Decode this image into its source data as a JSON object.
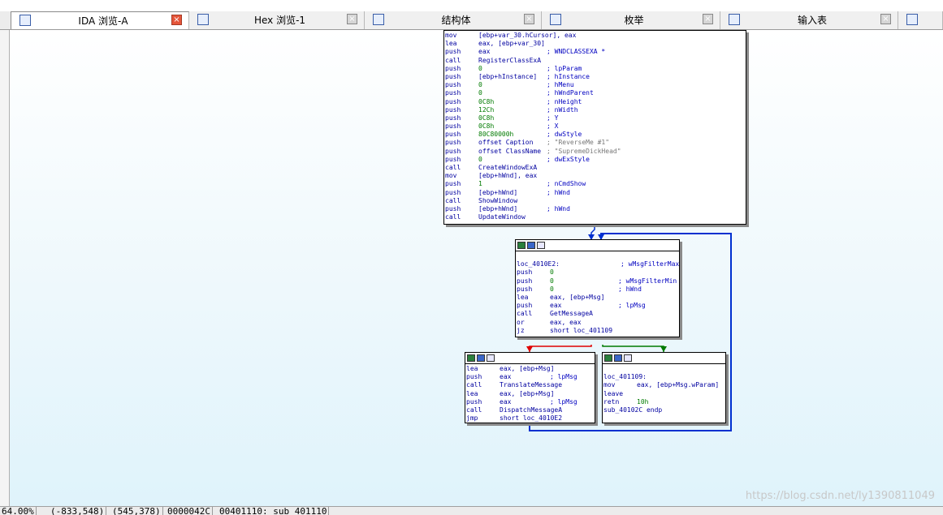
{
  "tabs": [
    {
      "label": "IDA 浏览-A",
      "icon": "ida-view-icon",
      "active": true
    },
    {
      "label": "Hex 浏览-1",
      "icon": "hex-view-icon",
      "active": false
    },
    {
      "label": "结构体",
      "icon": "structures-icon",
      "active": false
    },
    {
      "label": "枚举",
      "icon": "enums-icon",
      "active": false
    },
    {
      "label": "输入表",
      "icon": "imports-icon",
      "active": false
    }
  ],
  "nodes": {
    "main": [
      [
        "mov",
        "[ebp+var_30.hCursor], eax",
        ""
      ],
      [
        "lea",
        "eax, [ebp+var_30]",
        ""
      ],
      [
        "push",
        "eax",
        "; WNDCLASSEXA *"
      ],
      [
        "call",
        "RegisterClassExA",
        ""
      ],
      [
        "push",
        "0",
        "; lpParam"
      ],
      [
        "push",
        "[ebp+hInstance]",
        "; hInstance"
      ],
      [
        "push",
        "0",
        "; hMenu"
      ],
      [
        "push",
        "0",
        "; hWndParent"
      ],
      [
        "push",
        "0C8h",
        "; nHeight"
      ],
      [
        "push",
        "12Ch",
        "; nWidth"
      ],
      [
        "push",
        "0C8h",
        "; Y"
      ],
      [
        "push",
        "0C8h",
        "; X"
      ],
      [
        "push",
        "80C80000h",
        "; dwStyle"
      ],
      [
        "push",
        "offset Caption",
        "; \"ReverseMe #1\""
      ],
      [
        "push",
        "offset ClassName",
        "; \"SupremeDickHead\""
      ],
      [
        "push",
        "0",
        "; dwExStyle"
      ],
      [
        "call",
        "CreateWindowExA",
        ""
      ],
      [
        "mov",
        "[ebp+hWnd], eax",
        ""
      ],
      [
        "push",
        "1",
        "; nCmdShow"
      ],
      [
        "push",
        "[ebp+hWnd]",
        "; hWnd"
      ],
      [
        "call",
        "ShowWindow",
        ""
      ],
      [
        "push",
        "[ebp+hWnd]",
        "; hWnd"
      ],
      [
        "call",
        "UpdateWindow",
        ""
      ]
    ],
    "loop": [
      [
        "",
        "",
        ""
      ],
      [
        "loc_4010E2:",
        "",
        "; wMsgFilterMax"
      ],
      [
        "push",
        "0",
        ""
      ],
      [
        "push",
        "0",
        "; wMsgFilterMin"
      ],
      [
        "push",
        "0",
        "; hWnd"
      ],
      [
        "lea",
        "eax, [ebp+Msg]",
        ""
      ],
      [
        "push",
        "eax",
        "; lpMsg"
      ],
      [
        "call",
        "GetMessageA",
        ""
      ],
      [
        "or",
        "eax, eax",
        ""
      ],
      [
        "jz",
        "short loc_401109",
        ""
      ]
    ],
    "dispatch": [
      [
        "lea",
        "eax, [ebp+Msg]",
        ""
      ],
      [
        "push",
        "eax",
        "; lpMsg"
      ],
      [
        "call",
        "TranslateMessage",
        ""
      ],
      [
        "lea",
        "eax, [ebp+Msg]",
        ""
      ],
      [
        "push",
        "eax",
        "; lpMsg"
      ],
      [
        "call",
        "DispatchMessageA",
        ""
      ],
      [
        "jmp",
        "short loc_4010E2",
        ""
      ]
    ],
    "exit": [
      [
        "",
        "",
        ""
      ],
      [
        "loc_401109:",
        "",
        ""
      ],
      [
        "mov",
        "eax, [ebp+Msg.wParam]",
        ""
      ],
      [
        "leave",
        "",
        ""
      ],
      [
        "retn",
        "10h",
        ""
      ],
      [
        "sub_40102C endp",
        "",
        ""
      ]
    ]
  },
  "colors": {
    "edge_true": "#007a00",
    "edge_false": "#e00000",
    "edge_back": "#0030d0"
  },
  "status": {
    "zoom": "64.00%",
    "coords": "(-833,548)",
    "graph_pos": "(545,378)",
    "offset": "0000042C",
    "address": "00401110: sub_401110"
  },
  "watermark": "https://blog.csdn.net/ly1390811049"
}
